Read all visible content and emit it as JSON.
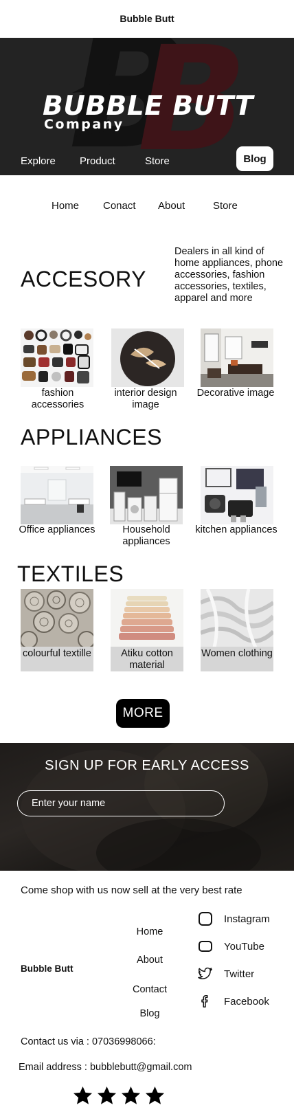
{
  "site_title": "Bubble Butt",
  "hero": {
    "brand": "BUBBLE BUTT",
    "company": "Company",
    "logo_letters": "BB",
    "nav": [
      "Explore",
      "Product",
      "Store"
    ],
    "blog_button": "Blog"
  },
  "subnav": [
    "Home",
    "Conact",
    "About",
    "Store"
  ],
  "accessory": {
    "title": "ACCESORY",
    "description": "Dealers in all kind of home appliances, phone accessories, fashion accessories, textiles, apparel and more",
    "items": [
      {
        "label": "fashion accessories",
        "icon": "jewelry-image"
      },
      {
        "label": "interior design image",
        "icon": "clock-image"
      },
      {
        "label": "Decorative image",
        "icon": "living-room-image"
      }
    ]
  },
  "appliances": {
    "title": "APPLIANCES",
    "items": [
      {
        "label": "Office appliances",
        "icon": "office-image"
      },
      {
        "label": "Household appliances",
        "icon": "household-image"
      },
      {
        "label": "kitchen appliances",
        "icon": "kitchen-image"
      }
    ]
  },
  "textiles": {
    "title": "TEXTILES",
    "items": [
      {
        "label": "colourful textille",
        "icon": "fabric-rolls-image"
      },
      {
        "label": "Atiku cotton material",
        "icon": "folded-cotton-image"
      },
      {
        "label": "Women clothing",
        "icon": "white-fabric-image"
      }
    ]
  },
  "more_button": "MORE",
  "signup": {
    "title": "SIGN UP FOR EARLY ACCESS",
    "placeholder": "Enter your name"
  },
  "footer": {
    "tagline": "Come shop with us now sell at the very best rate",
    "brand": "Bubble Butt",
    "links": [
      "Home",
      "About",
      "Contact",
      "Blog"
    ],
    "socials": [
      {
        "label": "Instagram",
        "icon": "instagram-icon"
      },
      {
        "label": "YouTube",
        "icon": "youtube-icon"
      },
      {
        "label": "Twitter",
        "icon": "twitter-icon"
      },
      {
        "label": "Facebook",
        "icon": "facebook-icon"
      }
    ],
    "contact": "Contact us via : 07036998066:",
    "email": "Email address : bubblebutt@gmail.com",
    "rating": 4
  },
  "colors": {
    "hero_bg": "#232323",
    "logo_dark": "#121212",
    "logo_red": "#3e1418",
    "button_black": "#000000",
    "textile_label_bg": "#d6d6d6"
  }
}
